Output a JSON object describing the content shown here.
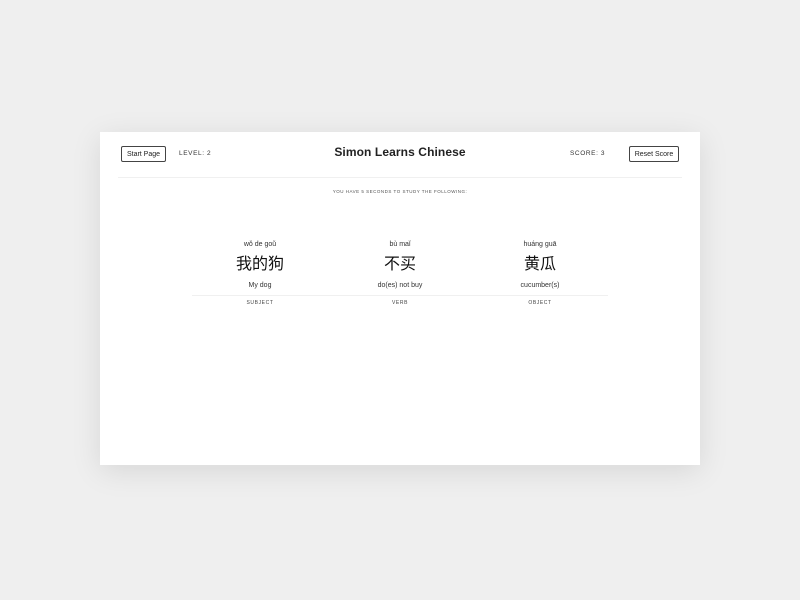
{
  "header": {
    "start_label": "Start Page",
    "level_text": "LEVEL: 2",
    "title": "Simon Learns Chinese",
    "score_text": "SCORE: 3",
    "reset_label": "Reset Score"
  },
  "instruction": "YOU HAVE 5 SECONDS TO STUDY THE FOLLOWING:",
  "words": [
    {
      "pinyin": "wǒ de goǔ",
      "hanzi": "我的狗",
      "meaning": "My dog",
      "role": "SUBJECT"
    },
    {
      "pinyin": "bù maǐ",
      "hanzi": "不买",
      "meaning": "do(es) not buy",
      "role": "VERB"
    },
    {
      "pinyin": "huáng guā",
      "hanzi": "黄瓜",
      "meaning": "cucumber(s)",
      "role": "OBJECT"
    }
  ]
}
